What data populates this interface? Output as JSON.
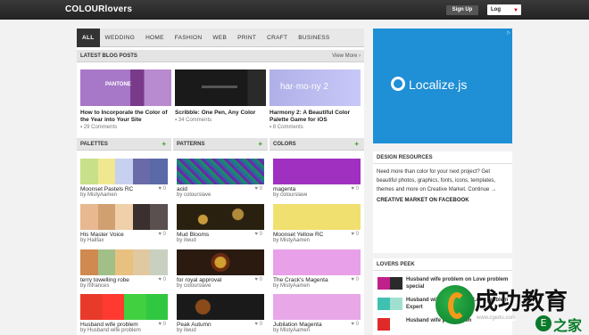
{
  "header": {
    "logo": "COLOURlovers",
    "signup": "Sign Up",
    "login": "Log"
  },
  "nav": {
    "tabs": [
      "ALL",
      "WEDDING",
      "HOME",
      "FASHION",
      "WEB",
      "PRINT",
      "CRAFT",
      "BUSINESS"
    ]
  },
  "blog": {
    "title": "LATEST BLOG POSTS",
    "view_more": "View More ›",
    "posts": [
      {
        "title": "How to Incorporate the Color of the Year into Your Site",
        "comments": "29 Comments",
        "thumb_text": "PANTONE"
      },
      {
        "title": "Scribble: One Pen, Any Color",
        "comments": "34 Comments",
        "thumb_text": ""
      },
      {
        "title": "Harmony 2: A Beautiful Color Palette Game for iOS",
        "comments": "8 Comments",
        "thumb_text": "har·mo·ny 2"
      }
    ]
  },
  "palettes": {
    "title": "PALETTES",
    "items": [
      {
        "name": "Moonset Pastels RC",
        "by": "by MistyAamen",
        "count": "0",
        "colors": [
          "#c8e08a",
          "#f0e890",
          "#c8d0f0",
          "#6a6aa8",
          "#5a6aa8"
        ]
      },
      {
        "name": "His Master Voice",
        "by": "by Halifax",
        "count": "0",
        "colors": [
          "#e8b890",
          "#d0a070",
          "#f0d0a8",
          "#3a3030",
          "#5a5050"
        ]
      },
      {
        "name": "terry towelling robe",
        "by": "by hifrances",
        "count": "0",
        "colors": [
          "#d08a50",
          "#a0c088",
          "#e8c080",
          "#e0c8a0",
          "#c8d0c0"
        ]
      },
      {
        "name": "Husband wife problem",
        "by": "by Husband wife problem",
        "count": "0",
        "colors": [
          "#e83a2a",
          "#ff3a30",
          "#40d040",
          "#30c840"
        ]
      }
    ]
  },
  "patterns": {
    "title": "PATTERNS",
    "items": [
      {
        "name": "acid",
        "by": "by colourslave",
        "count": "0"
      },
      {
        "name": "Mud Blooms",
        "by": "by ilwud",
        "count": "0"
      },
      {
        "name": "for royal approval",
        "by": "by colourslave",
        "count": "0"
      },
      {
        "name": "Peak Autumn",
        "by": "by ilwud",
        "count": "0"
      }
    ]
  },
  "colors": {
    "title": "COLORS",
    "items": [
      {
        "name": "magenta",
        "by": "by colourslave",
        "count": "0",
        "hex": "#a030c0"
      },
      {
        "name": "Moonset Yellow RC",
        "by": "by MistyAamen",
        "count": "0",
        "hex": "#f0e070"
      },
      {
        "name": "The Crack's Magenta",
        "by": "by MistyAamen",
        "count": "0",
        "hex": "#e8a0e8"
      },
      {
        "name": "Jubilation Magenta",
        "by": "by MistyAamen",
        "count": "0",
        "hex": "#e8a8e8"
      }
    ]
  },
  "ad": {
    "text": "Localize.js"
  },
  "design_resources": {
    "title": "DESIGN RESOURCES",
    "body": "Need more than color for your next project? Get beautiful photos, graphics, fonts, icons, templates, themes and more on Creative Market. Continue →",
    "facebook": "CREATIVE MARKET ON FACEBOOK"
  },
  "lovers_peek": {
    "title": "LOVERS PEEK",
    "items": [
      {
        "text": "Husband wife problem on Love problem special",
        "a": "#c0208a",
        "b": "#2a2a2a"
      },
      {
        "text": "Husband wife problem on Love problem Expert",
        "a": "#40c0b0",
        "b": "#a0e0d0"
      },
      {
        "text": "Husband wife problem on",
        "a": "#e02a2a",
        "b": "#ffffff"
      }
    ]
  },
  "watermark": {
    "cn": "成功教育",
    "zh": "E",
    "jia": "之家",
    "url": "www.cgedu.com"
  }
}
